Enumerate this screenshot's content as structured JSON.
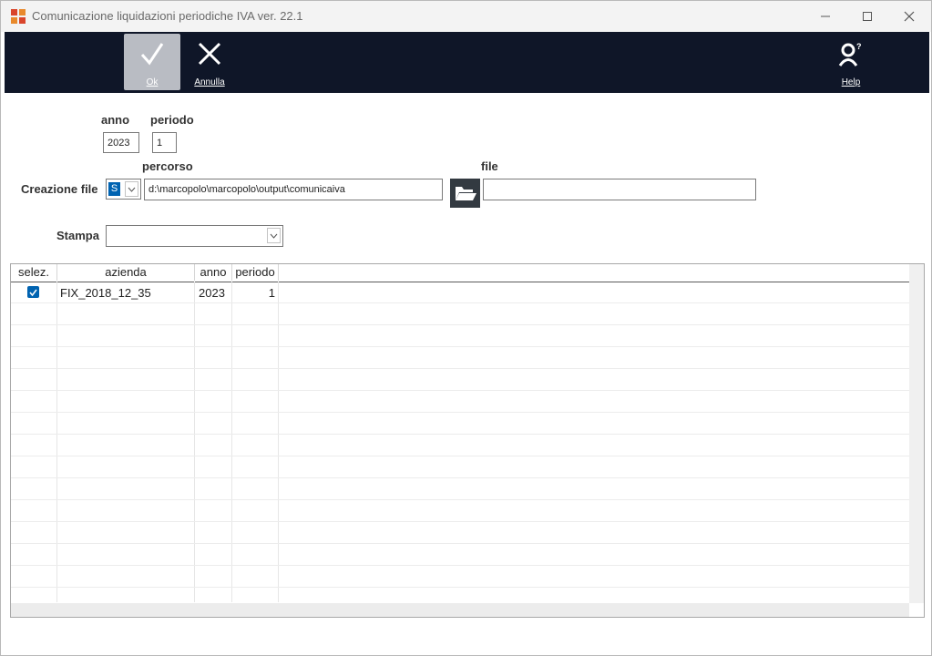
{
  "window": {
    "title": "Comunicazione liquidazioni periodiche IVA  ver. 22.1",
    "controls": {
      "minimize": "—",
      "maximize": "☐",
      "close": "✕"
    }
  },
  "toolbar": {
    "ok_label": "Ok",
    "cancel_label": "Annulla",
    "help_label": "Help"
  },
  "form": {
    "anno_label": "anno",
    "anno_value": "2023",
    "periodo_label": "periodo",
    "periodo_value": "1",
    "creazione_file_label": "Creazione file",
    "creazione_file_value": "S",
    "percorso_label": "percorso",
    "percorso_value": "d:\\marcopolo\\marcopolo\\output\\comunicaiva",
    "file_label": "file",
    "file_value": "",
    "stampa_label": "Stampa",
    "stampa_value": ""
  },
  "table": {
    "columns": [
      "selez.",
      "azienda",
      "anno",
      "periodo"
    ],
    "rows": [
      {
        "selected": true,
        "azienda": "FIX_2018_12_35",
        "anno": "2023",
        "periodo": "1"
      }
    ]
  },
  "colors": {
    "toolbar_bg": "#0f1628",
    "accent": "#0063b1",
    "icon_red": "#d9452b",
    "icon_orange": "#e8892c"
  }
}
